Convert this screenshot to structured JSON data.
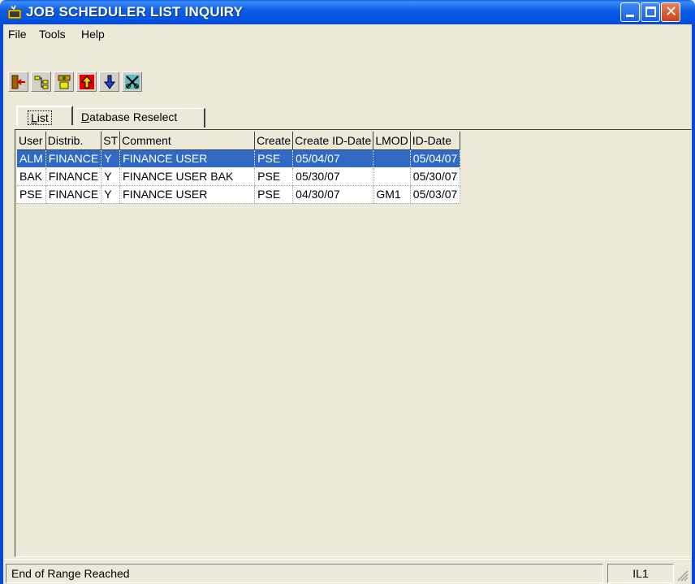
{
  "window": {
    "title": "JOB SCHEDULER LIST INQUIRY",
    "buttons": [
      "minimize",
      "maximize",
      "close"
    ]
  },
  "menu": {
    "items": [
      "File",
      "Tools",
      "Help"
    ]
  },
  "toolbar": {
    "buttons": [
      "exit-icon",
      "hierarchy-icon",
      "tree-icon",
      "arrow-up-icon",
      "arrow-down-icon",
      "scissors-icon"
    ]
  },
  "tabs": [
    {
      "label_pre": "",
      "label_u": "L",
      "label_post": "ist",
      "active": true
    },
    {
      "label_pre": "",
      "label_u": "D",
      "label_post": "atabase Reselect",
      "active": false
    }
  ],
  "grid": {
    "columns": [
      "User",
      "Distrib.",
      "ST",
      "Comment",
      "Create",
      "Create ID-Date",
      "LMOD",
      "ID-Date"
    ],
    "rows": [
      [
        "ALM",
        "FINANCE",
        "Y",
        "FINANCE USER",
        "PSE",
        "05/04/07",
        "",
        "05/04/07"
      ],
      [
        "BAK",
        "FINANCE",
        "Y",
        "FINANCE USER BAK",
        "PSE",
        "05/30/07",
        "",
        "05/30/07"
      ],
      [
        "PSE",
        "FINANCE",
        "Y",
        "FINANCE USER",
        "PSE",
        "04/30/07",
        "GM1",
        "05/03/07"
      ]
    ],
    "selected_row": 0
  },
  "status": {
    "message": "End of Range Reached",
    "code": "IL1"
  },
  "colors": {
    "title_bar": "#0053e0",
    "selection": "#316ac5",
    "window_bg": "#ece9d8"
  }
}
